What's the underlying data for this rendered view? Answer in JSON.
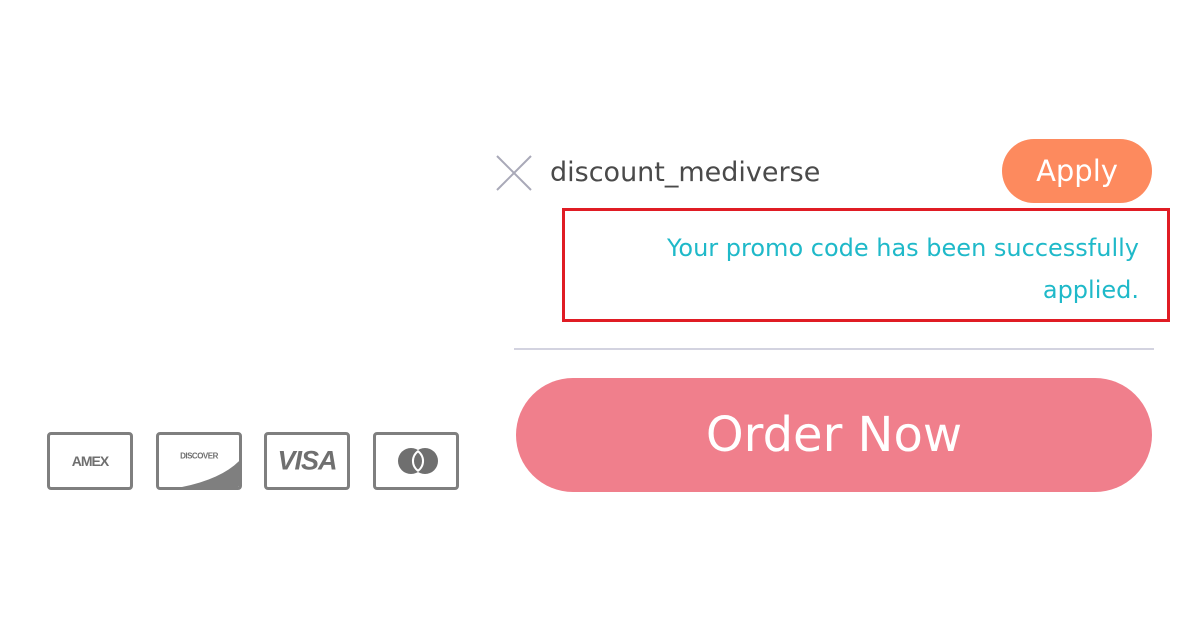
{
  "promo": {
    "code_value": "discount_mediverse",
    "clear_icon": "close-icon",
    "apply_label": "Apply",
    "apply_color": "#fd8a5e"
  },
  "message": {
    "text": "Your promo code has been successfully applied.",
    "text_color": "#1fb9c9",
    "highlight_border_color": "#e01c24"
  },
  "order": {
    "label": "Order Now",
    "color": "#f07f8c"
  },
  "payment_cards": [
    {
      "name": "amex-card-icon",
      "label": "AMEX"
    },
    {
      "name": "discover-card-icon",
      "label": "DISCOVER"
    },
    {
      "name": "visa-card-icon",
      "label": "VISA"
    },
    {
      "name": "mastercard-card-icon",
      "label": ""
    }
  ]
}
